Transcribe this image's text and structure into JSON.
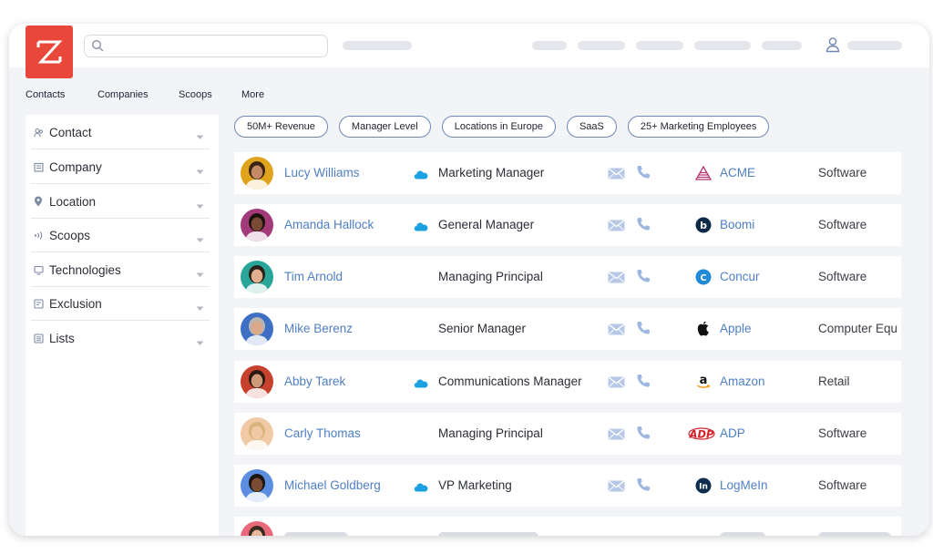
{
  "app": {
    "logo_label": "ZoomInfo logo",
    "accent_color": "#e8473a",
    "link_color": "#4f7fc4"
  },
  "search": {
    "placeholder": "",
    "value": ""
  },
  "tabs": [
    "Contacts",
    "Companies",
    "Scoops",
    "More"
  ],
  "sidebar": {
    "items": [
      {
        "label": "Contact",
        "icon": "contact-icon"
      },
      {
        "label": "Company",
        "icon": "company-icon"
      },
      {
        "label": "Location",
        "icon": "location-pin-icon"
      },
      {
        "label": "Scoops",
        "icon": "scoops-icon"
      },
      {
        "label": "Technologies",
        "icon": "technologies-icon"
      },
      {
        "label": "Exclusion",
        "icon": "exclusion-icon"
      },
      {
        "label": "Lists",
        "icon": "lists-icon"
      }
    ]
  },
  "filters": [
    "50M+ Revenue",
    "Manager Level",
    "Locations in Europe",
    "SaaS",
    "25+ Marketing Employees"
  ],
  "contacts": [
    {
      "name": "Lucy Williams",
      "salesforce": true,
      "title": "Marketing Manager",
      "company": "ACME",
      "company_logo": "acme-logo",
      "industry": "Software",
      "avatar_bg": "#e0a31c",
      "skin": "#c48a64",
      "hair": "#3b2314"
    },
    {
      "name": "Amanda Hallock",
      "salesforce": true,
      "title": "General Manager",
      "company": "Boomi",
      "company_logo": "boomi-logo",
      "industry": "Software",
      "avatar_bg": "#a33a7a",
      "skin": "#7a4a34",
      "hair": "#1c120d"
    },
    {
      "name": "Tim Arnold",
      "salesforce": false,
      "title": "Managing Principal",
      "company": "Concur",
      "company_logo": "concur-logo",
      "industry": "Software",
      "avatar_bg": "#2aa59a",
      "skin": "#e2b08f",
      "hair": "#2a2018"
    },
    {
      "name": "Mike Berenz",
      "salesforce": false,
      "title": "Senior Manager",
      "company": "Apple",
      "company_logo": "apple-logo",
      "industry": "Computer Equ",
      "avatar_bg": "#3d6fc4",
      "skin": "#dba98a",
      "hair": "#b9b5b1"
    },
    {
      "name": "Abby Tarek",
      "salesforce": true,
      "title": "Communications Manager",
      "company": "Amazon",
      "company_logo": "amazon-logo",
      "industry": "Retail",
      "avatar_bg": "#c8412e",
      "skin": "#cf9a78",
      "hair": "#2a1a12"
    },
    {
      "name": "Carly Thomas",
      "salesforce": false,
      "title": "Managing Principal",
      "company": "ADP",
      "company_logo": "adp-logo",
      "industry": "Software",
      "avatar_bg": "#f2c9a5",
      "skin": "#f0c9a7",
      "hair": "#d8b47a"
    },
    {
      "name": "Michael Goldberg",
      "salesforce": true,
      "title": "VP Marketing",
      "company": "LogMeIn",
      "company_logo": "logmein-logo",
      "industry": "Software",
      "avatar_bg": "#5b8de0",
      "skin": "#7a4c34",
      "hair": "#1b1410"
    },
    {
      "name": "",
      "salesforce": false,
      "title": "",
      "company": "",
      "company_logo": "",
      "industry": "",
      "avatar_bg": "#e86a7a",
      "skin": "#e9b79a",
      "hair": "#3a2a20"
    }
  ]
}
